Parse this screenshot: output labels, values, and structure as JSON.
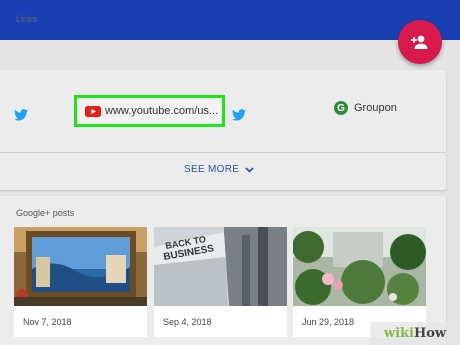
{
  "header": {
    "add_contact_icon": "person-add-icon",
    "fab_color": "#d71a4b",
    "bar_color": "#1a3fb3"
  },
  "links": {
    "label": "Links",
    "items": [
      {
        "type": "twitter",
        "icon": "twitter-icon"
      },
      {
        "type": "youtube",
        "icon": "youtube-icon",
        "text": "www.youtube.com/us..."
      },
      {
        "type": "twitter",
        "icon": "twitter-icon"
      },
      {
        "type": "groupon",
        "icon": "groupon-icon",
        "text": "Groupon"
      }
    ],
    "see_more": "SEE MORE",
    "highlight_color": "#1fe61a"
  },
  "posts": {
    "label": "Google+ posts",
    "items": [
      {
        "date": "Nov 7, 2018"
      },
      {
        "date": "Sep 4, 2018",
        "sign_text": "BACK TO BUSINESS"
      },
      {
        "date": "Jun 29, 2018"
      }
    ]
  },
  "watermark": {
    "part1": "wiki",
    "part2": "How"
  }
}
